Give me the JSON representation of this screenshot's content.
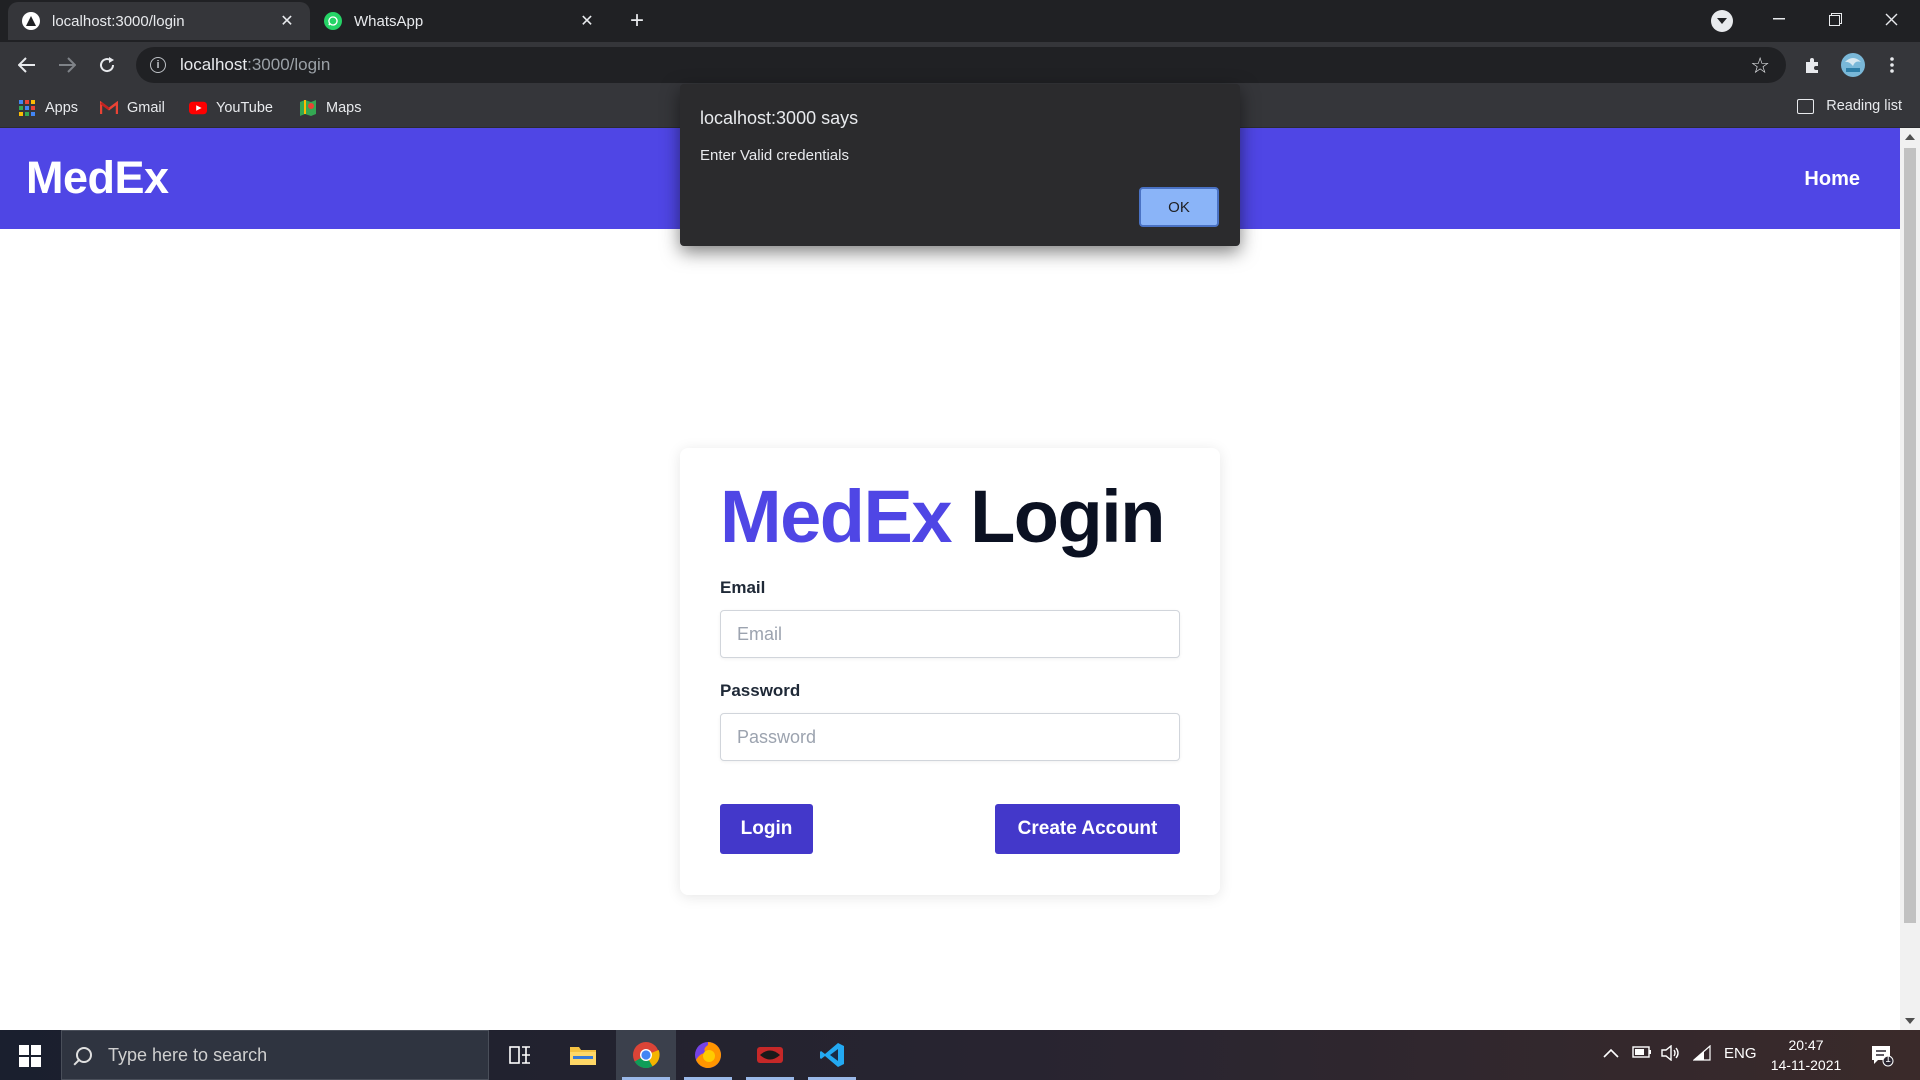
{
  "browser": {
    "tabs": [
      {
        "title": "localhost:3000/login",
        "active": true,
        "favicon": "triangle-icon"
      },
      {
        "title": "WhatsApp",
        "active": false,
        "favicon": "whatsapp-icon"
      }
    ],
    "close_glyph": "✕",
    "new_tab_glyph": "+",
    "address": {
      "host": "localhost",
      "path": ":3000/login"
    },
    "bookmarks": [
      {
        "label": "Apps",
        "icon": "apps-grid-icon"
      },
      {
        "label": "Gmail",
        "icon": "gmail-icon"
      },
      {
        "label": "YouTube",
        "icon": "youtube-icon"
      },
      {
        "label": "Maps",
        "icon": "maps-icon"
      }
    ],
    "reading_list": "Reading list"
  },
  "page": {
    "navbar": {
      "brand": "MedEx",
      "home_link": "Home"
    },
    "login_card": {
      "title_brand": "MedEx",
      "title_word": "Login",
      "email_label": "Email",
      "email_placeholder": "Email",
      "password_label": "Password",
      "password_placeholder": "Password",
      "login_button": "Login",
      "create_account_button": "Create Account"
    }
  },
  "dialog": {
    "title": "localhost:3000 says",
    "message": "Enter Valid credentials",
    "ok_label": "OK"
  },
  "taskbar": {
    "search_placeholder": "Type here to search",
    "language": "ENG",
    "time": "20:47",
    "date": "14-11-2021",
    "notification_count": "1"
  },
  "colors": {
    "brand": "#4f46e5",
    "button": "#4338ca",
    "dialog_ok": "#8ab4f8"
  }
}
